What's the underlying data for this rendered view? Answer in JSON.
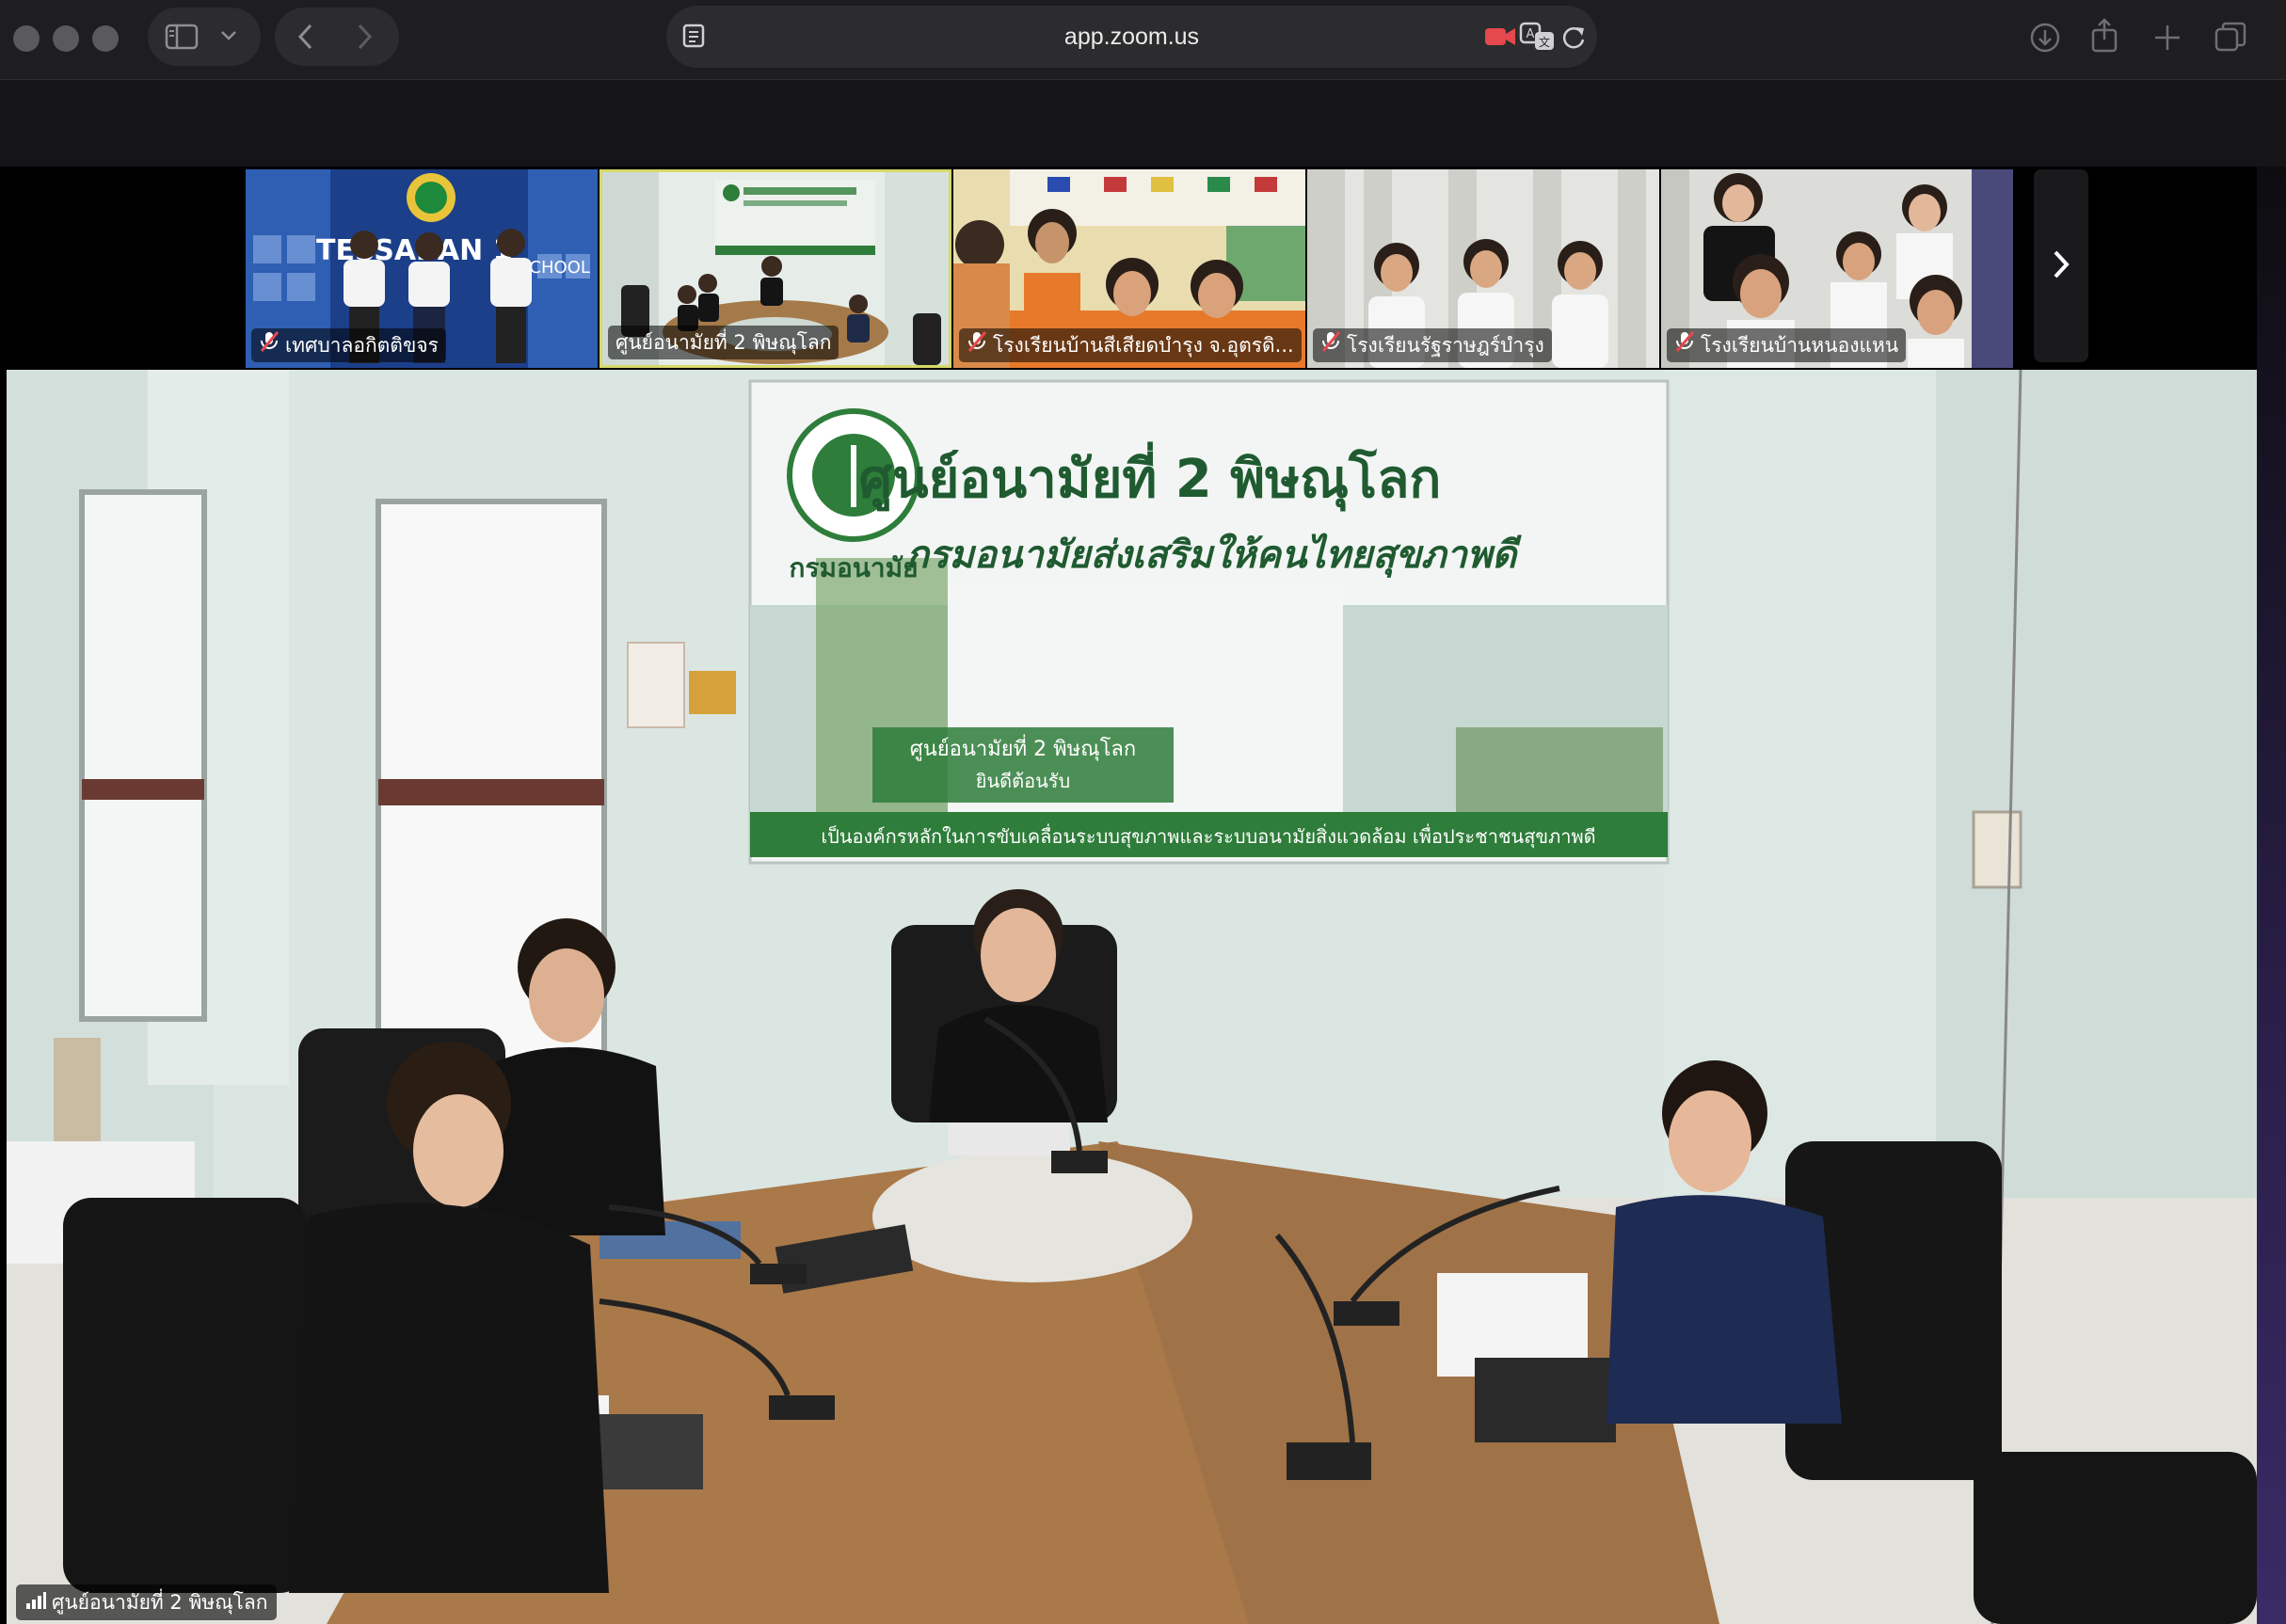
{
  "browser": {
    "url": "app.zoom.us",
    "icons": [
      "sidebar-icon",
      "chevron-down-icon",
      "back-icon",
      "forward-icon",
      "reader-icon",
      "camera-recording-icon",
      "translate-icon",
      "reload-icon",
      "download-icon",
      "share-icon",
      "new-tab-icon",
      "tab-overview-icon"
    ],
    "accent_recording": "#e5484d"
  },
  "gallery": {
    "participants": [
      {
        "name": "เทศบาลอกิตติขจร",
        "muted": true,
        "active": false
      },
      {
        "name": "ศูนย์อนามัยที่ 2 พิษณุโลก",
        "muted": false,
        "active": true
      },
      {
        "name": "โรงเรียนบ้านสีเสียดบำรุง จ.อุตรดิ...",
        "muted": true,
        "active": false
      },
      {
        "name": "โรงเรียนรัฐราษฎร์บำรุง",
        "muted": true,
        "active": false
      },
      {
        "name": "โรงเรียนบ้านหนองแหน",
        "muted": true,
        "active": false
      }
    ],
    "tile0_banner": "TESSABAN 1",
    "tile0_banner_sub": "SCHOOL",
    "active_border_color": "#d6d86a",
    "next_icon": "chevron-right-icon"
  },
  "main_video": {
    "speaker_name": "ศูนย์อนามัยที่ 2 พิษณุโลก",
    "signal_icon": "signal-bars-icon",
    "banner_title": "ศูนย์อนามัยที่ 2 พิษณุโลก",
    "banner_subtitle": "กรมอนามัยส่งเสริมให้คนไทยสุขภาพดี",
    "banner_logo_caption": "กรมอนามัย",
    "banner_sign_line1": "ศูนย์อนามัยที่ 2 พิษณุโลก",
    "banner_sign_line2": "ยินดีต้อนรับ",
    "banner_footer": "เป็นองค์กรหลักในการขับเคลื่อนระบบสุขภาพและระบบอนามัยสิ่งแวดล้อม เพื่อประชาชนสุขภาพดี",
    "banner_green": "#2e7d3a"
  }
}
